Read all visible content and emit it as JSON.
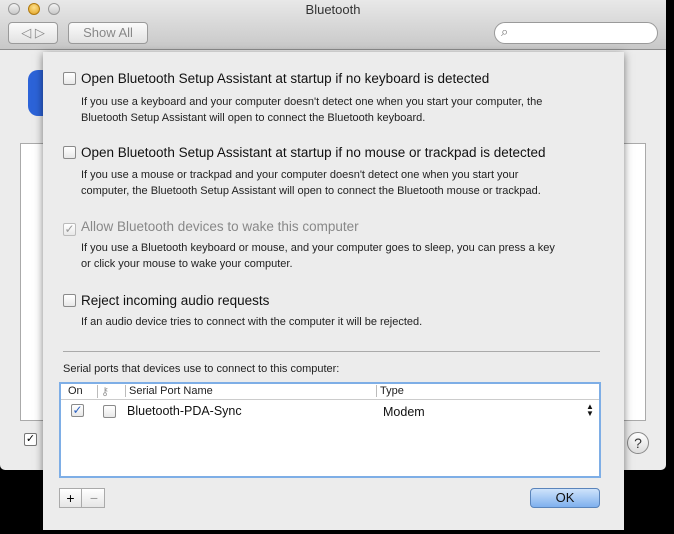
{
  "window": {
    "title": "Bluetooth",
    "show_all": "Show All",
    "search_placeholder": "",
    "help": "?"
  },
  "sheet": {
    "options": [
      {
        "label": "Open Bluetooth Setup Assistant at startup if no keyboard is detected",
        "checked": false,
        "enabled": true,
        "desc": [
          "If you use a keyboard and your computer doesn't detect one when you start your computer, the",
          "Bluetooth Setup Assistant will open to connect the Bluetooth keyboard."
        ]
      },
      {
        "label": "Open Bluetooth Setup Assistant at startup if no mouse or trackpad is detected",
        "checked": false,
        "enabled": true,
        "desc": [
          "If you use a mouse or trackpad and your computer doesn't detect one when you start your",
          "computer, the Bluetooth Setup Assistant will open to connect the Bluetooth mouse or trackpad."
        ]
      },
      {
        "label": "Allow Bluetooth devices to wake this computer",
        "checked": true,
        "enabled": false,
        "desc": [
          "If you use a Bluetooth keyboard or mouse, and your computer goes to sleep, you can press a key",
          "or click your mouse to wake your computer."
        ]
      },
      {
        "label": "Reject incoming audio requests",
        "checked": false,
        "enabled": true,
        "desc": [
          "If an audio device tries to connect with the computer it will be rejected.",
          ""
        ]
      }
    ],
    "serial_caption": "Serial ports that devices use to connect to this computer:",
    "table": {
      "columns": [
        "On",
        "key-icon",
        "Serial Port Name",
        "Type"
      ],
      "rows": [
        {
          "on": true,
          "secure": false,
          "name": "Bluetooth-PDA-Sync",
          "type": "Modem"
        }
      ]
    },
    "add": "+",
    "remove": "−",
    "ok": "OK",
    "check_mark": "✓"
  }
}
